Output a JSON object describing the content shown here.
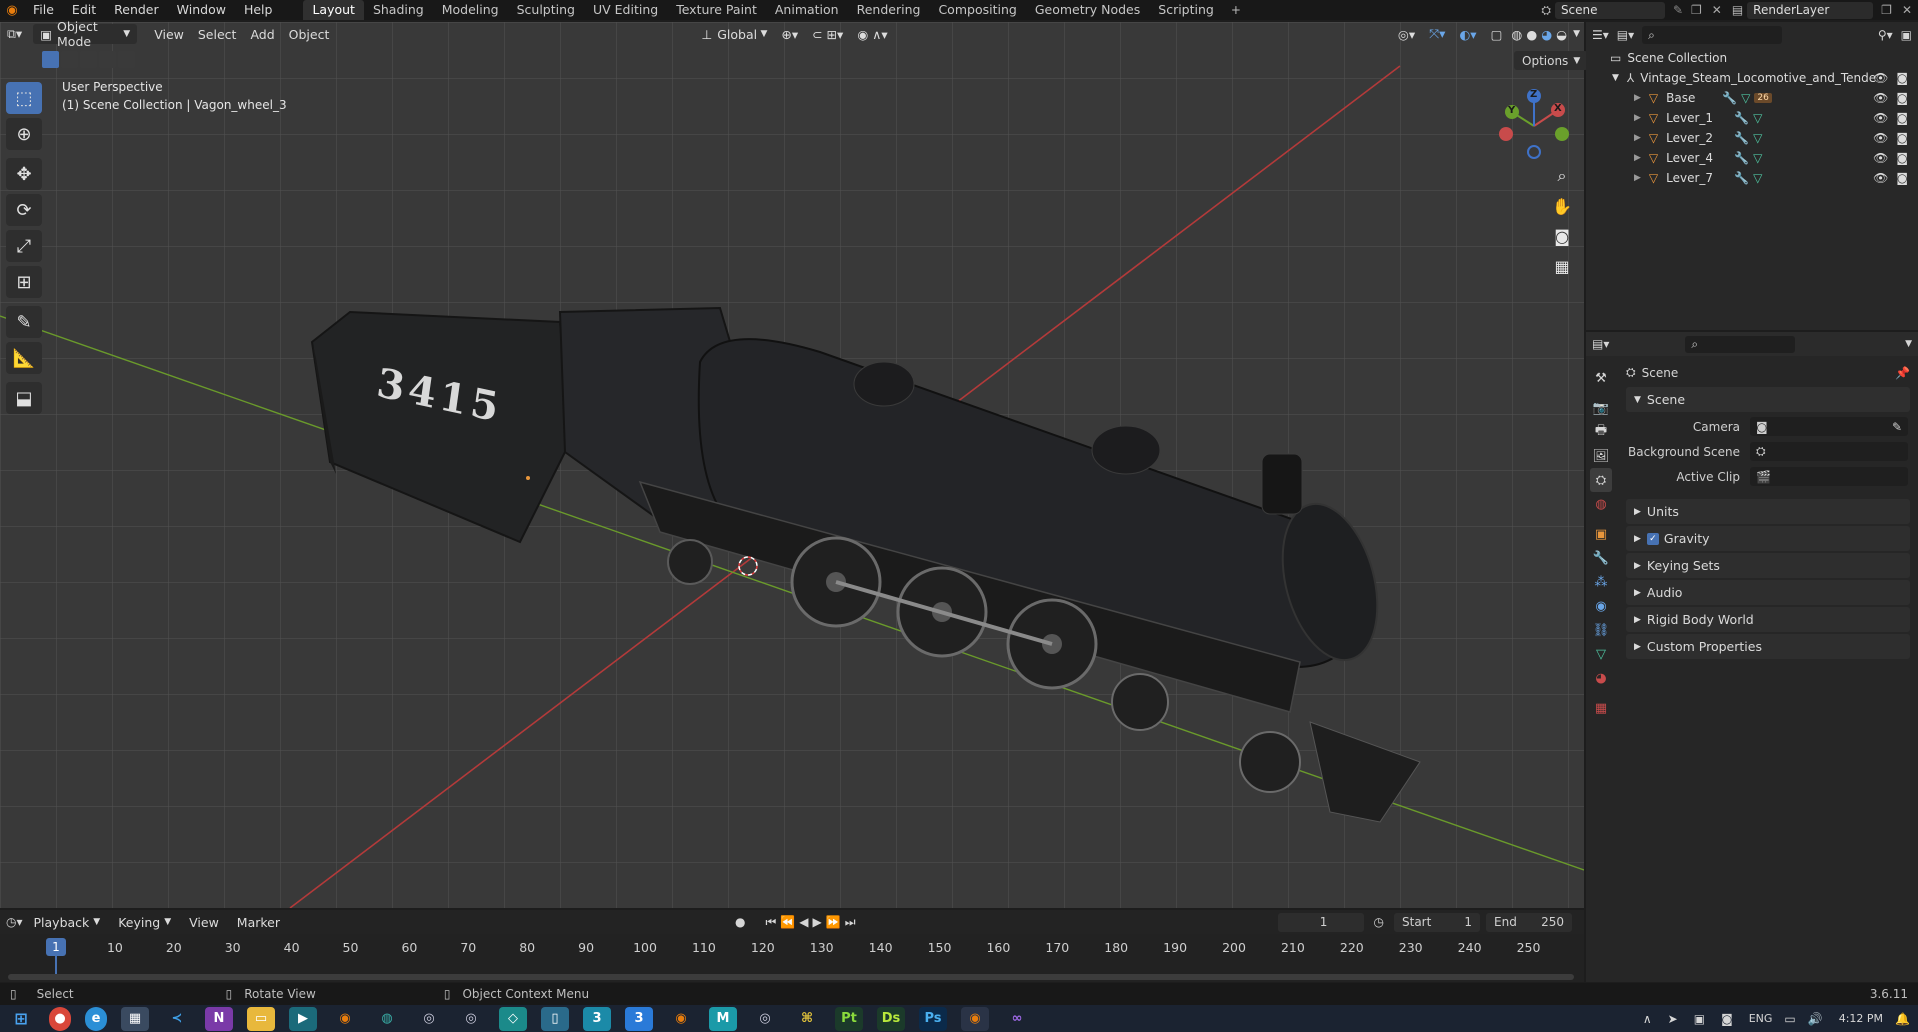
{
  "menu": {
    "items": [
      "File",
      "Edit",
      "Render",
      "Window",
      "Help"
    ],
    "workspaces": [
      "Layout",
      "Shading",
      "Modeling",
      "Sculpting",
      "UV Editing",
      "Texture Paint",
      "Animation",
      "Rendering",
      "Compositing",
      "Geometry Nodes",
      "Scripting"
    ],
    "active_workspace": "Layout",
    "scene_name": "Scene",
    "view_layer": "RenderLayer"
  },
  "viewport": {
    "mode": "Object Mode",
    "menus": [
      "View",
      "Select",
      "Add",
      "Object"
    ],
    "transform_orientation": "Global",
    "options_label": "Options",
    "perspective_label": "User Perspective",
    "collection_label": "(1) Scene Collection | Vagon_wheel_3",
    "locomotive_number": "3415",
    "axes": {
      "x": "X",
      "y": "Y",
      "z": "Z"
    },
    "grid_x_color": "#b33a3a",
    "grid_y_color": "#6a9a2b"
  },
  "outliner": {
    "root": "Scene Collection",
    "collection": "Vintage_Steam_Locomotive_and_Tende",
    "items": [
      {
        "name": "Base",
        "badge": "26"
      },
      {
        "name": "Lever_1"
      },
      {
        "name": "Lever_2"
      },
      {
        "name": "Lever_4"
      },
      {
        "name": "Lever_7"
      }
    ]
  },
  "properties": {
    "context": "Scene",
    "section": "Scene",
    "fields": [
      {
        "label": "Camera"
      },
      {
        "label": "Background Scene"
      },
      {
        "label": "Active Clip"
      }
    ],
    "panels": [
      "Units",
      "Gravity",
      "Keying Sets",
      "Audio",
      "Rigid Body World",
      "Custom Properties"
    ]
  },
  "timeline": {
    "menus": [
      "Playback",
      "Keying",
      "View",
      "Marker"
    ],
    "current_frame": "1",
    "start_label": "Start",
    "start": "1",
    "end_label": "End",
    "end": "250",
    "frame_labels": [
      "10",
      "20",
      "30",
      "40",
      "50",
      "60",
      "70",
      "80",
      "90",
      "100",
      "110",
      "120",
      "130",
      "140",
      "150",
      "160",
      "170",
      "180",
      "190",
      "200",
      "210",
      "220",
      "230",
      "240",
      "250"
    ]
  },
  "status": {
    "select": "Select",
    "rotate": "Rotate View",
    "context_menu": "Object Context Menu",
    "version": "3.6.11"
  },
  "taskbar": {
    "language": "ENG",
    "time": "4:12 PM"
  },
  "colors": {
    "accent": "#4772b3",
    "object_orange": "#e8963c",
    "modifier_blue": "#6aa6e8",
    "mesh_green": "#4fc3a0"
  }
}
